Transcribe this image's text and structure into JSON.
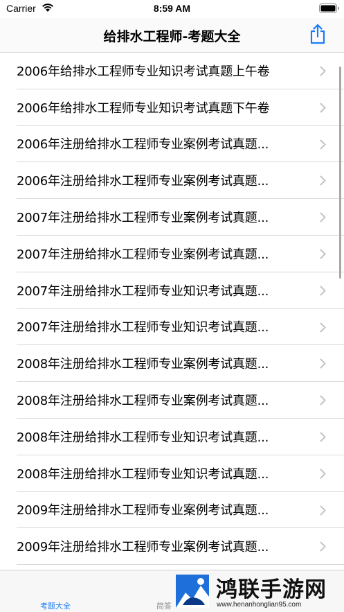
{
  "status_bar": {
    "carrier": "Carrier",
    "time": "8:59 AM"
  },
  "nav": {
    "title": "给排水工程师-考题大全",
    "share_icon": "share-icon",
    "accent_color": "#1a7cf5"
  },
  "list": {
    "items": [
      {
        "label": "2006年给排水工程师专业知识考试真题上午卷"
      },
      {
        "label": "2006年给排水工程师专业知识考试真题下午卷"
      },
      {
        "label": "2006年注册给排水工程师专业案例考试真题..."
      },
      {
        "label": "2006年注册给排水工程师专业案例考试真题..."
      },
      {
        "label": "2007年注册给排水工程师专业案例考试真题..."
      },
      {
        "label": "2007年注册给排水工程师专业案例考试真题..."
      },
      {
        "label": "2007年注册给排水工程师专业知识考试真题..."
      },
      {
        "label": "2007年注册给排水工程师专业知识考试真题..."
      },
      {
        "label": "2008年注册给排水工程师专业案例考试真题..."
      },
      {
        "label": "2008年注册给排水工程师专业案例考试真题..."
      },
      {
        "label": "2008年注册给排水工程师专业知识考试真题..."
      },
      {
        "label": "2008年注册给排水工程师专业知识考试真题..."
      },
      {
        "label": "2009年注册给排水工程师专业案例考试真题..."
      },
      {
        "label": "2009年注册给排水工程师专业案例考试真题..."
      }
    ]
  },
  "tab_bar": {
    "tabs": [
      {
        "label": "考题大全",
        "active": true
      },
      {
        "label": "简答",
        "active": false
      }
    ]
  },
  "watermark": {
    "text": "鸿联手游网",
    "url": "www.henanhonglian95.com"
  }
}
